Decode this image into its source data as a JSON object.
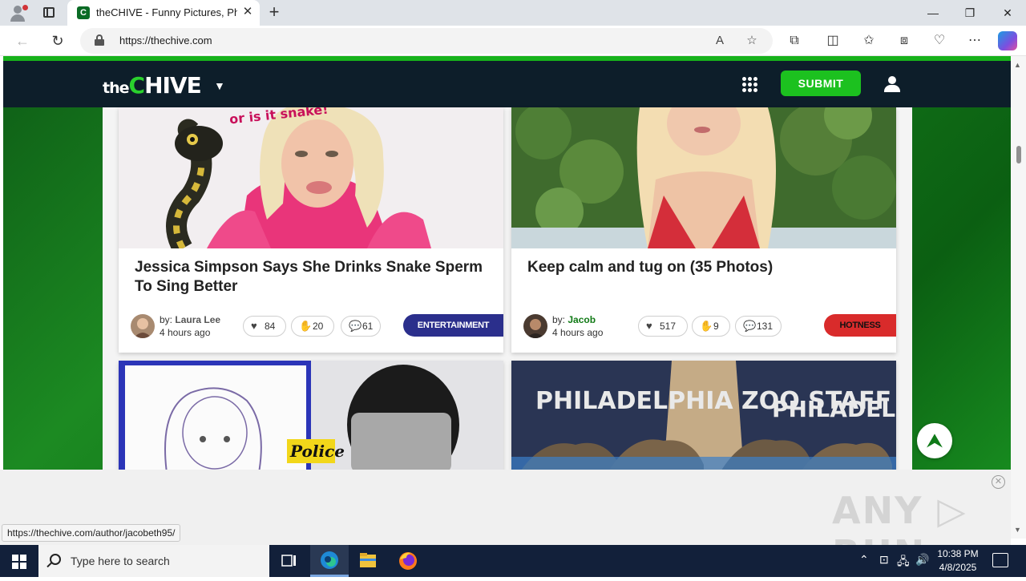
{
  "browser": {
    "tab_title": "theCHIVE - Funny Pictures, Photos, Memes",
    "url": "https://thechive.com",
    "new_tab_symbol": "+",
    "close_tab_symbol": "✕",
    "window_controls": {
      "minimize": "—",
      "restore": "❐",
      "close": "✕"
    }
  },
  "site": {
    "logo_the": "the",
    "logo_c": "C",
    "logo_hive": "HIVE",
    "submit_label": "SUBMIT"
  },
  "posts": [
    {
      "headline": "Jessica Simpson Says She Drinks Snake Sperm To Sing Better",
      "image_caption": "or is it snake!",
      "by_prefix": "by:",
      "author": "Laura Lee",
      "time_ago": "4 hours ago",
      "likes": "84",
      "dislikes": "20",
      "comments": "61",
      "category": "ENTERTAINMENT",
      "category_color": "#2b2f8c"
    },
    {
      "headline": "Keep calm and tug on (35 Photos)",
      "by_prefix": "by:",
      "author": "Jacob",
      "time_ago": "4 hours ago",
      "likes": "517",
      "dislikes": "9",
      "comments": "131",
      "category": "HOTNESS",
      "category_color": "#d92b2b"
    },
    {
      "image_caption": "Police"
    },
    {
      "image_caption_1": "PHILADELPHIA ZOO STAFF",
      "image_caption_2": "PHILADELPHIA ZOO STAFF"
    }
  ],
  "status_bar_url": "https://thechive.com/author/jacobeth95/",
  "watermark": "ANY ▷ RUN",
  "taskbar": {
    "search_placeholder": "Type here to search",
    "time": "10:38 PM",
    "date": "4/8/2025"
  }
}
